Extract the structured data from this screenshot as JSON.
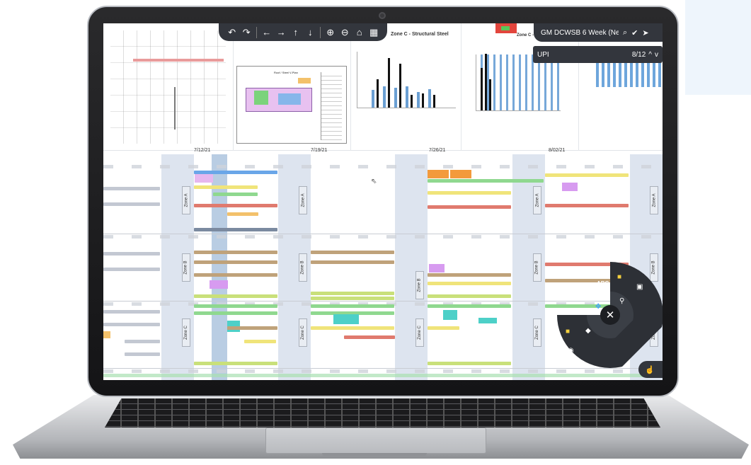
{
  "toolbar": {
    "undo": "↶",
    "redo": "↷",
    "left": "←",
    "right": "→",
    "up": "↑",
    "down": "↓",
    "zoom_in": "⊕",
    "zoom_out": "⊖",
    "home": "⌂",
    "grid": "▦"
  },
  "document": {
    "title": "GM DCWSB 6 Week (Ne...",
    "icons": [
      "page-search-icon",
      "check-circle-icon",
      "share-icon"
    ]
  },
  "search": {
    "query": "UPI",
    "count": "8/12",
    "prev": "^",
    "next": "v"
  },
  "thumbnails": {
    "sheet_title": "Roof / Steel V-Plan",
    "zone_c_title": "Zone C - Structural Steel",
    "zone_c_short": "Zone C - St"
  },
  "calendar": {
    "dates": [
      "7/12/21",
      "7/19/21",
      "7/26/21",
      "8/02/21"
    ],
    "zones": [
      "Zone A",
      "Zone B",
      "Zone C"
    ]
  },
  "radial_menu": {
    "center": "✕",
    "items": [
      "ABC",
      "folder-icon",
      "image-icon",
      "search-icon",
      "expand-icon",
      "pen-icon",
      "sticky-note-icon",
      "layers-icon",
      "palette-icon"
    ]
  },
  "colors": {
    "toolbar": "#33363d",
    "weekend": "#dde4ef",
    "task_colors": [
      "#e89a9a",
      "#f0e47a",
      "#bfa27a",
      "#8fd88f",
      "#6aa6e8",
      "#c7a3e0",
      "#4dd0c8",
      "#f3c16b"
    ]
  }
}
